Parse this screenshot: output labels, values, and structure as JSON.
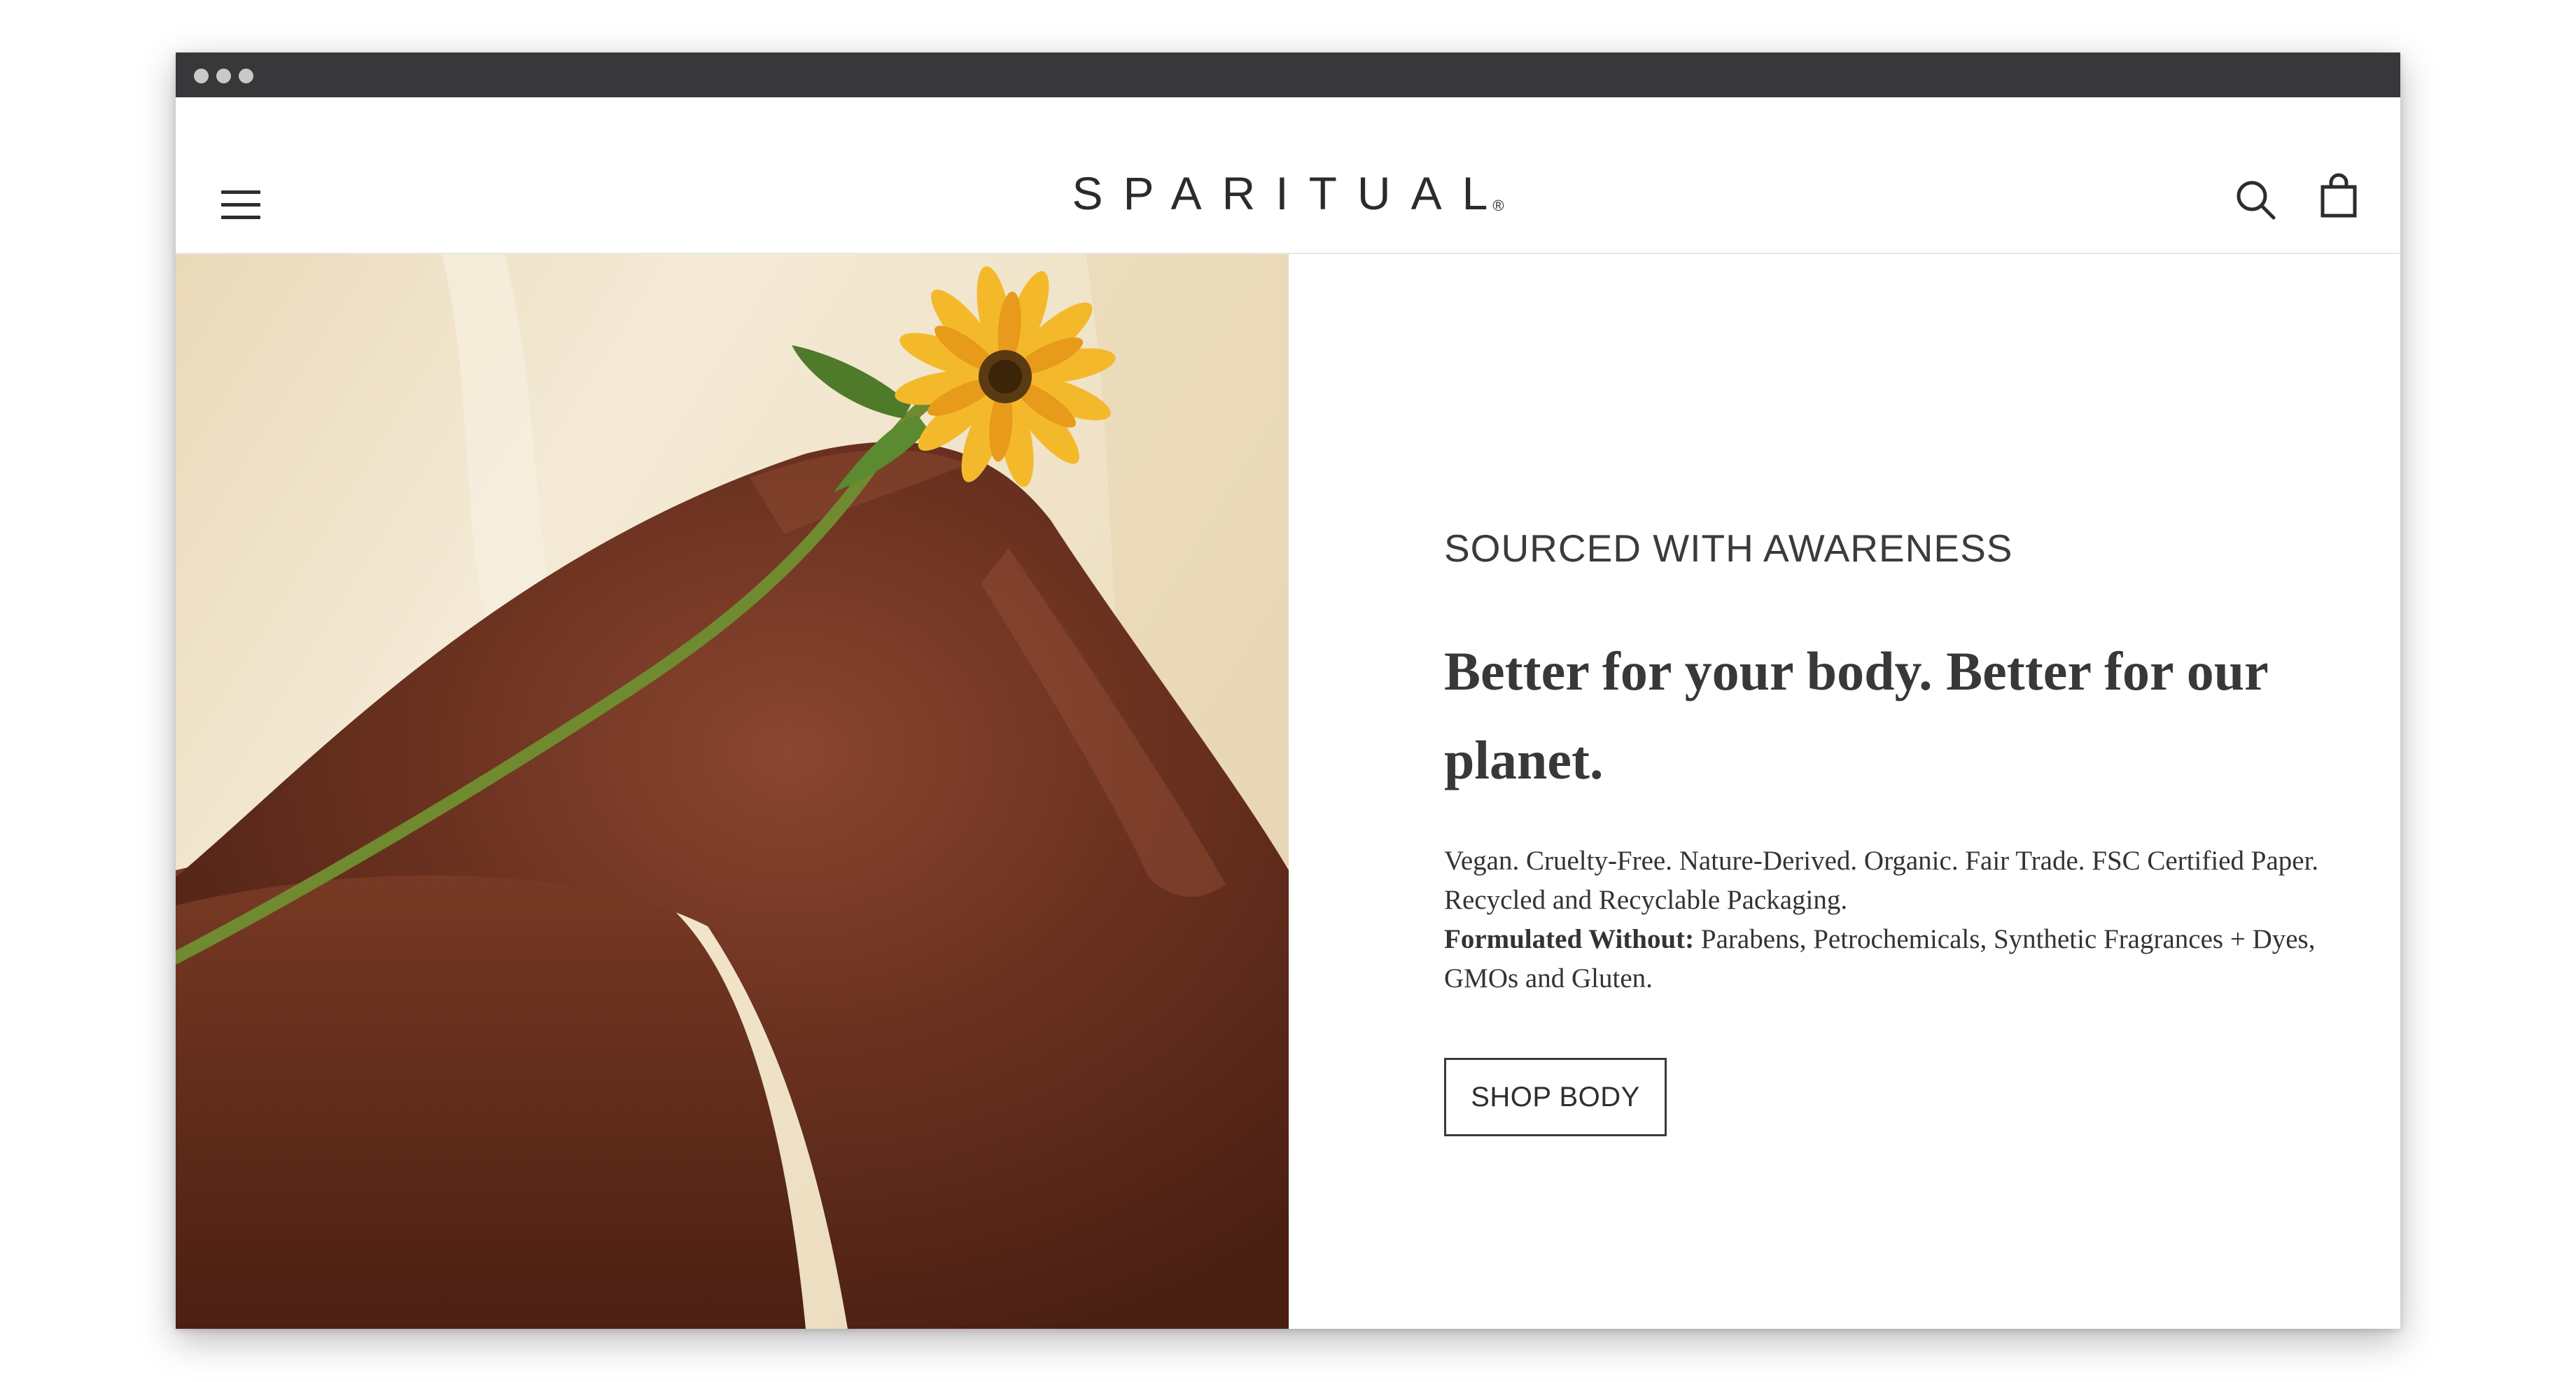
{
  "window": {
    "controls": [
      "close",
      "minimize",
      "maximize"
    ]
  },
  "header": {
    "menu_icon": "hamburger-menu-icon",
    "logo_text": "SPARITUAL",
    "logo_mark": "®",
    "search_icon": "search-icon",
    "cart_icon": "shopping-bag-icon"
  },
  "hero": {
    "image_subject": "legs with a sunflower",
    "colors": {
      "background": "#efe3cc",
      "skin": "#6b3220",
      "petal": "#f4b92b",
      "stem": "#6f8a2f"
    }
  },
  "content": {
    "eyebrow": "SOURCED WITH AWARENESS",
    "headline": "Better for your body. Better for our planet.",
    "paragraph_1": "Vegan. Cruelty-Free. Nature-Derived. Organic. Fair Trade. FSC Certified Paper. Recycled and Recyclable Packaging.",
    "paragraph_2_label": "Formulated Without:",
    "paragraph_2_text": " Parabens, Petrochemicals, Synthetic Fragrances + Dyes, GMOs and Gluten.",
    "button_label": "SHOP BODY"
  },
  "colors": {
    "titlebar": "#38383a",
    "text_dark": "#333333",
    "button_border": "#3a3a3a"
  }
}
